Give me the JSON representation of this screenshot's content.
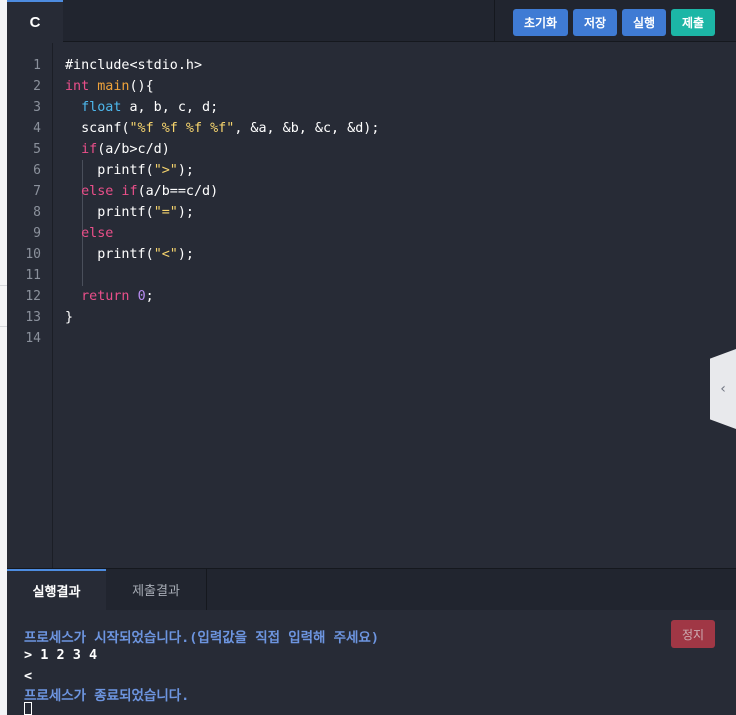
{
  "editor": {
    "language_tab": "C",
    "buttons": {
      "reset": "초기화",
      "save": "저장",
      "run": "실행",
      "submit": "제출"
    },
    "line_numbers": [
      "1",
      "2",
      "3",
      "4",
      "5",
      "6",
      "7",
      "8",
      "9",
      "10",
      "11",
      "12",
      "13",
      "14"
    ],
    "code": {
      "l1": {
        "t": "#include<stdio.h>"
      },
      "l2": {
        "kw": "int",
        "fn": "main",
        "t": "(){"
      },
      "l3": {
        "ty": "float",
        "t": "a, b, c, d;"
      },
      "l4": {
        "fn": "scanf",
        "t1": "(",
        "st": "\"%f %f %f %f\"",
        "t2": ", &a, &b, &c, &d);"
      },
      "l5": {
        "kw": "if",
        "t": "(a/b>c/d)"
      },
      "l6": {
        "fn": "printf",
        "t1": "(",
        "st": "\">\"",
        "t2": ");"
      },
      "l7": {
        "kw": "else if",
        "t": "(a/b==c/d)"
      },
      "l8": {
        "fn": "printf",
        "t1": "(",
        "st": "\"=\"",
        "t2": ");"
      },
      "l9": {
        "kw": "else"
      },
      "l10": {
        "fn": "printf",
        "t1": "(",
        "st": "\"<\"",
        "t2": ");"
      },
      "l12": {
        "kw": "return",
        "nm": "0",
        "t": ";"
      },
      "l13": {
        "t": "}"
      }
    },
    "colors": {
      "keyword": "#ea4f8a",
      "type": "#4db7ec",
      "function": "#f0a33a",
      "string": "#f6d46d",
      "number": "#b78cf0",
      "accent": "#3f7bd4",
      "submit": "#1cb6a6"
    }
  },
  "output": {
    "tabs": {
      "run_result": "실행결과",
      "submit_result": "제출결과"
    },
    "stop_button": "정지",
    "lines": {
      "start": "프로세스가 시작되었습니다.(입력값을 직접 입력해 주세요)",
      "input": "> 1 2 3 4",
      "result": "<",
      "end": "프로세스가 종료되었습니다."
    }
  },
  "icons": {
    "collapse": "chevron-left-icon"
  }
}
